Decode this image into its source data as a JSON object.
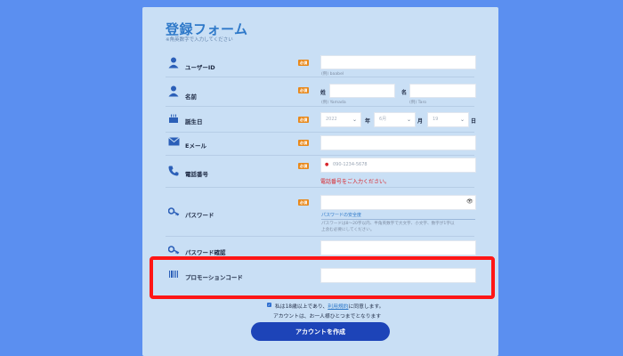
{
  "form": {
    "title": "登録フォーム",
    "subtitle": "※角英数字で入力してください",
    "required_badge": "必須",
    "colors": {
      "background": "#5b8ff0",
      "panel": "#c9dff5",
      "accent": "#2f79c9",
      "required": "#e8881a",
      "error": "#d8252b",
      "highlight": "#ff1616",
      "button": "#1d44b8"
    }
  },
  "user_id": {
    "label": "ユーザーID",
    "placeholder": "",
    "hint": "(例) baabel",
    "icon": "person-icon"
  },
  "name": {
    "label": "名前",
    "icon": "person-icon",
    "last_label": "姓",
    "first_label": "名",
    "last_hint": "(例) Yamada",
    "first_hint": "(例) Taro"
  },
  "birthday": {
    "label": "誕生日",
    "icon": "cake-icon",
    "year_value": "2022",
    "month_value": "6月",
    "day_value": "19",
    "year_unit": "年",
    "month_unit": "月",
    "day_unit": "日"
  },
  "email": {
    "label": "Eメール",
    "icon": "mail-icon"
  },
  "phone": {
    "label": "電話番号",
    "icon": "phone-icon",
    "flag": "●",
    "placeholder": "090-1234-5678",
    "error": "電話番号をご入力ください。"
  },
  "password": {
    "label": "パスワード",
    "icon": "key-icon",
    "strength_label": "パスワードの安全度",
    "rules_line1": "パスワードは8〜20字以内、半角英数字で大文字、小文字、数字が1字以",
    "rules_line2": "上含む必要にしてください。"
  },
  "password_confirm": {
    "label": "パスワード確認",
    "icon": "key-icon"
  },
  "promo": {
    "label": "プロモーションコード",
    "icon": "barcode-icon"
  },
  "agreement": {
    "prefix": "私は18歳以上であり、",
    "link": "利用規約",
    "suffix": "に同意します。",
    "note": "アカウントは、お一人様ひとつまでとなります"
  },
  "submit_label": "アカウントを作成"
}
